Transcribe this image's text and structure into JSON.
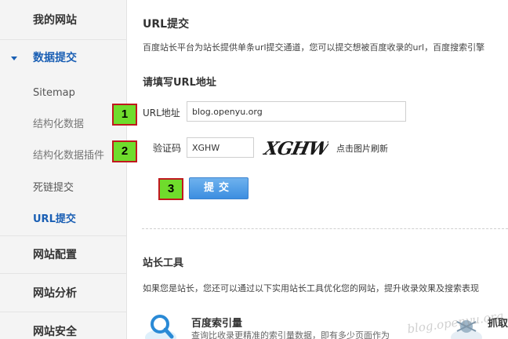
{
  "sidebar": {
    "groups": [
      {
        "label": "我的网站"
      },
      {
        "label": "数据提交"
      },
      {
        "label": "网站配置"
      },
      {
        "label": "网站分析"
      },
      {
        "label": "网站安全"
      }
    ],
    "sub_items": [
      {
        "label": "Sitemap"
      },
      {
        "label": "结构化数据"
      },
      {
        "label": "结构化数据插件"
      },
      {
        "label": "死链提交"
      },
      {
        "label": "URL提交"
      }
    ]
  },
  "main": {
    "title": "URL提交",
    "description": "百度站长平台为站长提供单条url提交通道，您可以提交想被百度收录的url，百度搜索引擎",
    "form_title": "请填写URL地址",
    "url_label": "URL地址",
    "url_value": "blog.openyu.org",
    "captcha_label": "验证码",
    "captcha_value": "XGHW",
    "captcha_image_text": "XGHW",
    "refresh_label": "点击图片刷新",
    "submit_label": "提交"
  },
  "annotations": [
    "1",
    "2",
    "3"
  ],
  "tools": {
    "title": "站长工具",
    "description": "如果您是站长，您还可以通过以下实用站长工具优化您的网站，提升收录效果及搜索表现",
    "items": [
      {
        "name": "百度索引量",
        "desc": "查询比收录更精准的索引量数据，即有多少页面作为",
        "icon": "magnifier-icon"
      },
      {
        "name": "抓取",
        "icon": "spider-icon"
      }
    ]
  },
  "watermark": "blog.openyu.org",
  "colors": {
    "accent": "#1a5fb4",
    "badge_fill": "#6fdc2c",
    "badge_border": "#c0181e",
    "button": "#4a9be6"
  }
}
